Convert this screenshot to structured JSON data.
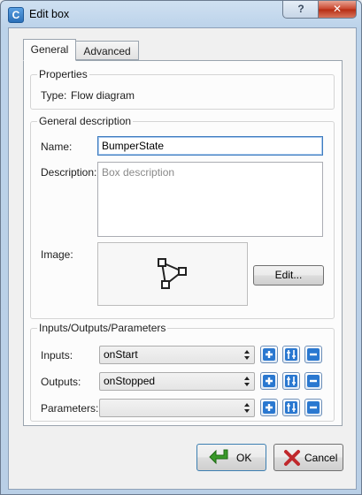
{
  "window": {
    "title": "Edit box",
    "app_icon_letter": "C",
    "help_label": "?",
    "close_label": "✕"
  },
  "tabs": [
    {
      "label": "General",
      "active": true
    },
    {
      "label": "Advanced",
      "active": false
    }
  ],
  "properties": {
    "group_title": "Properties",
    "type_label": "Type:",
    "type_value": "Flow diagram"
  },
  "general_description": {
    "group_title": "General description",
    "name_label": "Name:",
    "name_value": "BumperState",
    "description_label": "Description:",
    "description_placeholder": "Box description",
    "image_label": "Image:",
    "image_icon": "flow-diagram-icon",
    "edit_button_label": "Edit..."
  },
  "io": {
    "group_title": "Inputs/Outputs/Parameters",
    "rows": [
      {
        "label": "Inputs:",
        "value": "onStart"
      },
      {
        "label": "Outputs:",
        "value": "onStopped"
      },
      {
        "label": "Parameters:",
        "value": ""
      }
    ],
    "row_icons": [
      "add-icon",
      "edit-icon",
      "remove-icon"
    ]
  },
  "footer": {
    "ok_label": "OK",
    "cancel_label": "Cancel"
  },
  "colors": {
    "accent_blue": "#2a6fb8",
    "ok_green": "#3a9a2a",
    "cancel_red": "#c0282c"
  }
}
